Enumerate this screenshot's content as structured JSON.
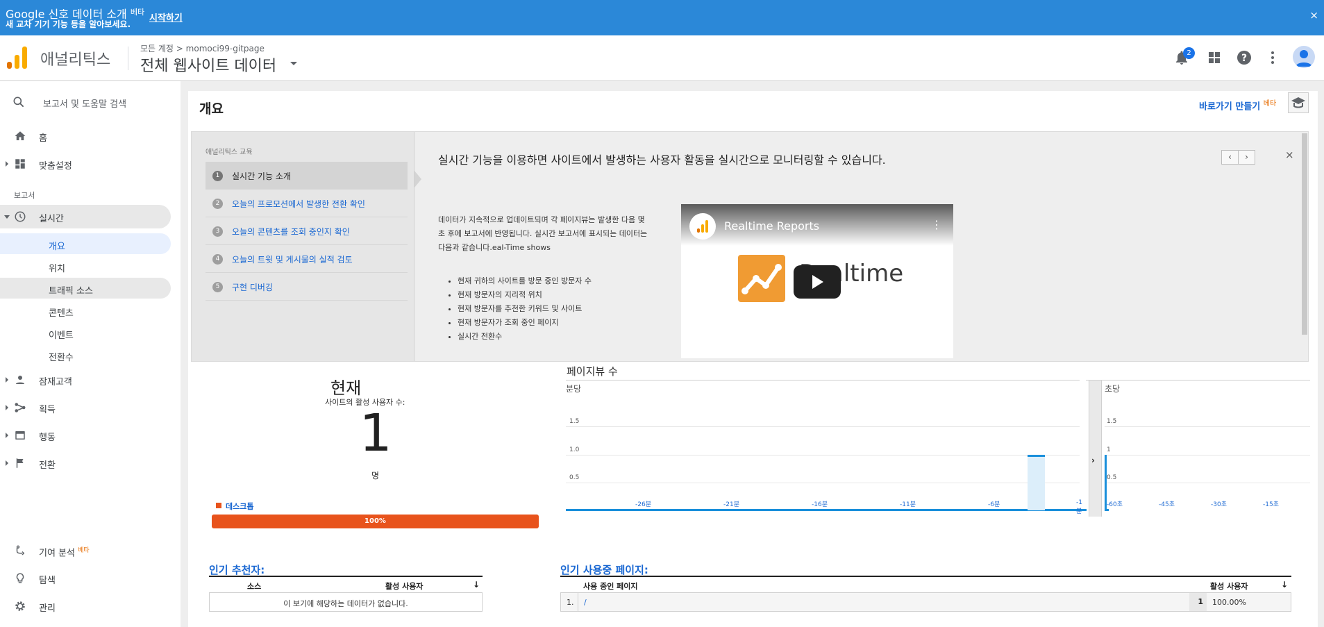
{
  "banner": {
    "title": "Google 신호 데이터 소개",
    "beta": "베타",
    "subtitle": "새 교차 기기 기능 등을 알아보세요.",
    "start_link": "시작하기",
    "close": "×"
  },
  "header": {
    "app_name": "애널리틱스",
    "breadcrumb": "모든 계정 > momoci99-gitpage",
    "view_name": "전체 웹사이트 데이터",
    "notification_count": "2"
  },
  "sidebar": {
    "search_placeholder": "보고서 및 도움말 검색",
    "home": "홈",
    "customization": "맞춤설정",
    "reports_label": "보고서",
    "realtime": "실시간",
    "realtime_items": [
      "개요",
      "위치",
      "트래픽 소스",
      "콘텐츠",
      "이벤트",
      "전환수"
    ],
    "audience": "잠재고객",
    "acquisition": "획득",
    "behavior": "행동",
    "conversions": "전환",
    "attribution": "기여 분석",
    "attribution_beta": "베타",
    "discover": "탐색",
    "admin": "관리"
  },
  "main": {
    "title": "개요",
    "shortcut": "바로가기 만들기",
    "shortcut_beta": "베타"
  },
  "education": {
    "heading": "애널리틱스 교육",
    "steps": [
      {
        "num": "1",
        "label": "실시간 기능 소개"
      },
      {
        "num": "2",
        "label": "오늘의 프로모션에서 발생한 전환 확인"
      },
      {
        "num": "3",
        "label": "오늘의 콘텐츠를 조회 중인지 확인"
      },
      {
        "num": "4",
        "label": "오늘의 트윗 및 게시물의 실적 검토"
      },
      {
        "num": "5",
        "label": "구현 디버깅"
      }
    ],
    "headline": "실시간 기능을 이용하면 사이트에서 발생하는 사용자 활동을 실시간으로 모니터링할 수 있습니다.",
    "body": "데이터가 지속적으로 업데이트되며 각 페이지뷰는 발생한 다음 몇 초 후에 보고서에 반영됩니다. 실시간 보고서에 표시되는 데이터는 다음과 같습니다.eal-Time shows",
    "bullets": [
      "현재 귀하의 사이트를 방문 중인 방문자 수",
      "현재 방문자의 지리적 위치",
      "현재 방문자를 추천한 키워드 및 사이트",
      "현재 방문자가 조회 중인 페이지",
      "실시간 전환수"
    ],
    "prev": "‹",
    "next": "›",
    "close": "×",
    "video_title": "Realtime Reports",
    "video_word": "Realtime"
  },
  "now": {
    "title": "현재",
    "subtitle": "사이트의 활성 사용자 수:",
    "count": "1",
    "unit": "명",
    "device_label": "데스크톱",
    "device_share": 1.0,
    "device_percent": "100%"
  },
  "chart_data": [
    {
      "type": "bar",
      "title": "페이지뷰 수",
      "subtitle": "분당",
      "x_ticks": [
        "-26분",
        "-21분",
        "-16분",
        "-11분",
        "-6분",
        "-1분"
      ],
      "y_ticks": [
        "0.5",
        "1.0",
        "1.5"
      ],
      "ylim": [
        0,
        2
      ],
      "series": [
        {
          "values_by_minutes_ago": [
            {
              "x": -2,
              "y": 1
            }
          ]
        }
      ]
    },
    {
      "type": "bar",
      "subtitle": "초당",
      "x_ticks": [
        "-60초",
        "-45초",
        "-30초",
        "-15초"
      ],
      "y_ticks": [
        "0.5",
        "1",
        "1.5"
      ],
      "ylim": [
        0,
        2
      ],
      "series": [
        {
          "values_by_seconds_ago": [
            {
              "x": -60,
              "y": 1
            }
          ]
        }
      ]
    }
  ],
  "referrers": {
    "title": "인기 추천자:",
    "col_source": "소스",
    "col_active": "활성 사용자",
    "empty": "이 보기에 해당하는 데이터가 없습니다."
  },
  "pages": {
    "title": "인기 사용중 페이지:",
    "col_page": "사용 중인 페이지",
    "col_active": "활성 사용자",
    "rows": [
      {
        "rank": "1.",
        "page": "/",
        "users": "1",
        "percent": "100.00%"
      }
    ]
  },
  "colors": {
    "banner": "#2b88d8",
    "accent": "#1967d2",
    "desktop": "#e8531c",
    "bar": "#1a8fdb"
  }
}
